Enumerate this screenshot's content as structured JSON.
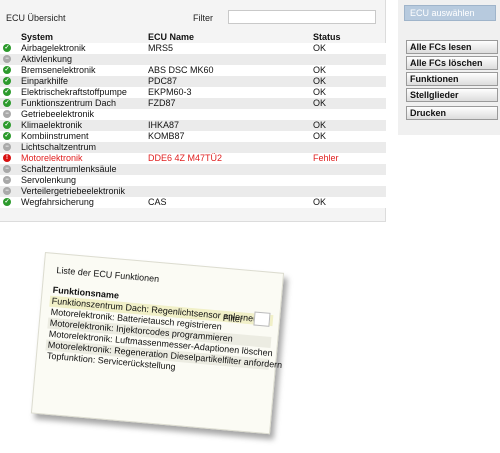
{
  "ecu_overview": {
    "title": "ECU Übersicht",
    "filter_label": "Filter",
    "filter_value": "",
    "columns": {
      "system": "System",
      "ecu_name": "ECU Name",
      "status": "Status"
    },
    "rows": [
      {
        "system": "Airbagelektronik",
        "ecu_name": "MRS5",
        "status": "OK",
        "state": "ok"
      },
      {
        "system": "Aktivlenkung",
        "ecu_name": "",
        "status": "",
        "state": "none"
      },
      {
        "system": "Bremsenelektronik",
        "ecu_name": "ABS DSC MK60",
        "status": "OK",
        "state": "ok"
      },
      {
        "system": "Einparkhilfe",
        "ecu_name": "PDC87",
        "status": "OK",
        "state": "ok"
      },
      {
        "system": "Elektrischekraftstoffpumpe",
        "ecu_name": "EKPM60-3",
        "status": "OK",
        "state": "ok"
      },
      {
        "system": "Funktionszentrum Dach",
        "ecu_name": "FZD87",
        "status": "OK",
        "state": "ok"
      },
      {
        "system": "Getriebeelektronik",
        "ecu_name": "",
        "status": "",
        "state": "none"
      },
      {
        "system": "Klimaelektronik",
        "ecu_name": "IHKA87",
        "status": "OK",
        "state": "ok"
      },
      {
        "system": "Kombiinstrument",
        "ecu_name": "KOMB87",
        "status": "OK",
        "state": "ok"
      },
      {
        "system": "Lichtschaltzentrum",
        "ecu_name": "",
        "status": "",
        "state": "none"
      },
      {
        "system": "Motorelektronik",
        "ecu_name": "DDE6 4Z M47TÜ2",
        "status": "Fehler",
        "state": "error"
      },
      {
        "system": "Schaltzentrumlenksäule",
        "ecu_name": "",
        "status": "",
        "state": "none"
      },
      {
        "system": "Servolenkung",
        "ecu_name": "",
        "status": "",
        "state": "none"
      },
      {
        "system": "Verteilergetriebeelektronik",
        "ecu_name": "",
        "status": "",
        "state": "none"
      },
      {
        "system": "Wegfahrsicherung",
        "ecu_name": "CAS",
        "status": "OK",
        "state": "ok"
      }
    ]
  },
  "sidebar": {
    "ecu_select": "ECU auswählen",
    "buttons": [
      "Alle FCs lesen",
      "Alle FCs löschen",
      "Funktionen",
      "Stellglieder",
      "Drucken"
    ]
  },
  "function_card": {
    "title": "Liste der ECU Funktionen",
    "filter_label": "Filter",
    "column_header": "Funktionsname",
    "items": [
      "Funktionszentrum Dach: Regenlichtsensor anlernen",
      "Motorelektronik: Batterietausch registrieren",
      "Motorelektronik: Injektorcodes programmieren",
      "Motorelektronik: Luftmassenmesser-Adaptionen löschen",
      "Motorelektronik: Regeneration Dieselpartikelfilter anfordern",
      "Topfunktion: Servicerückstellung"
    ]
  },
  "colors": {
    "ok": "#2c9a2c",
    "none": "#a9a9a9",
    "error": "#d81010",
    "error_text": "#e02020",
    "ecu_select_button": "#b7cade"
  },
  "icons": {
    "ok": "check-circle-icon",
    "none": "neutral-circle-icon",
    "error": "error-circle-icon"
  }
}
